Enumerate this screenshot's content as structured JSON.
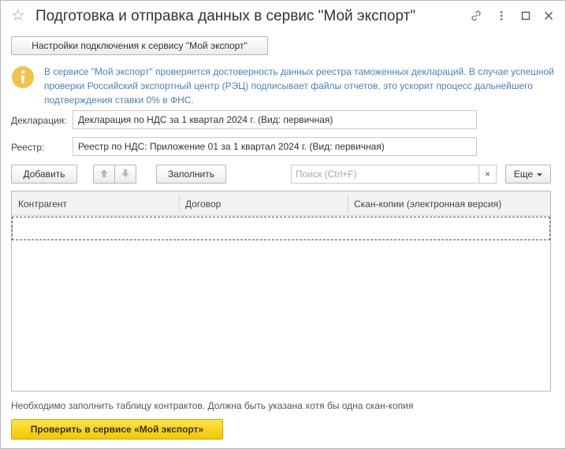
{
  "window": {
    "title": "Подготовка и отправка данных в сервис \"Мой экспорт\""
  },
  "toolbar": {
    "connection_settings_label": "Настройки подключения к сервису \"Мой экспорт\""
  },
  "info": {
    "text": "В сервисе \"Мой экспорт\" проверяется достоверность данных реестра таможенных деклараций. В случае успешной проверки Российский экспортный центр (РЭЦ) подписывает файлы отчетов, это ускорит процесс дальнейшего подтверждения ставки 0% в ФНС."
  },
  "form": {
    "declaration_label": "Декларация:",
    "declaration_value": "Декларация по НДС за 1 квартал 2024 г. (Вид: первичная)",
    "registry_label": "Реестр:",
    "registry_value": "Реестр по НДС: Приложение 01 за 1 квартал 2024 г. (Вид: первичная)"
  },
  "table_toolbar": {
    "add_label": "Добавить",
    "fill_label": "Заполнить",
    "search_placeholder": "Поиск (Ctrl+F)",
    "clear_label": "×",
    "more_label": "Еще"
  },
  "table": {
    "columns": [
      "Контрагент",
      "Договор",
      "Скан-копии (электронная версия)"
    ],
    "rows": []
  },
  "footer": {
    "hint": "Необходимо заполнить таблицу контрактов. Должна быть указана хотя бы одна скан-копия",
    "check_button_label": "Проверить в сервисе «Мой экспорт»"
  },
  "colors": {
    "info_text": "#4a80b8",
    "primary_button": "#f2c800",
    "info_icon": "#f2c14e"
  },
  "icons": {
    "favorite": "star-icon",
    "link": "link-icon",
    "menu": "more-vertical-icon",
    "maximize": "maximize-icon",
    "close": "close-icon",
    "info": "info-icon",
    "move_up": "arrow-up-icon",
    "move_down": "arrow-down-icon"
  }
}
